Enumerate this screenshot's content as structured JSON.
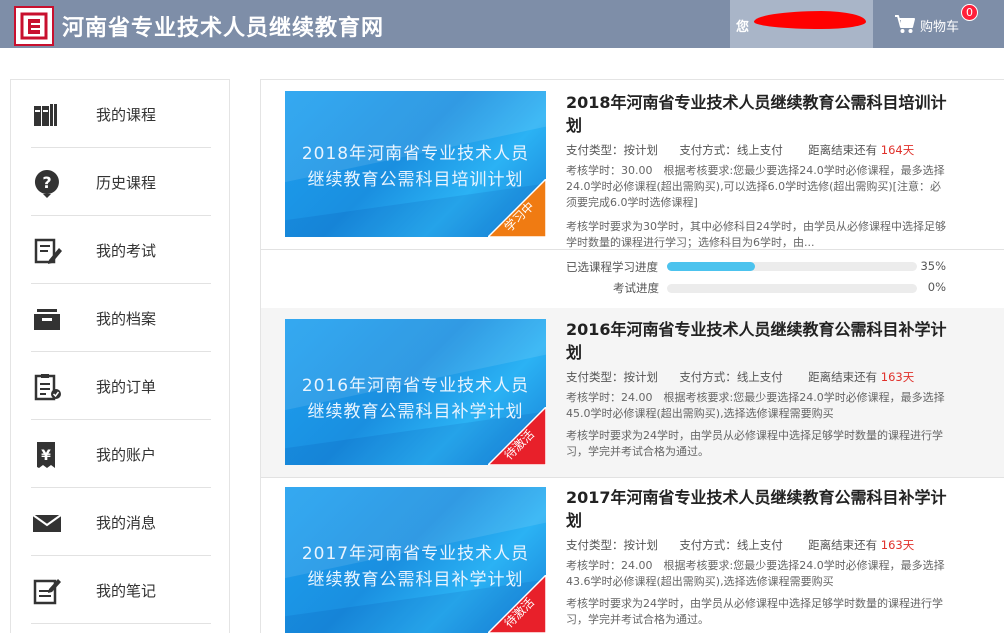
{
  "header": {
    "site_title": "河南省专业技术人员继续教育网",
    "user_greeting": "您",
    "cart_label": "购物车",
    "cart_count": "0"
  },
  "sidebar": {
    "items": [
      {
        "label": "我的课程",
        "icon": "books-icon"
      },
      {
        "label": "历史课程",
        "icon": "question-icon"
      },
      {
        "label": "我的考试",
        "icon": "exam-edit-icon"
      },
      {
        "label": "我的档案",
        "icon": "archive-box-icon"
      },
      {
        "label": "我的订单",
        "icon": "order-clipboard-icon"
      },
      {
        "label": "我的账户",
        "icon": "yen-account-icon"
      },
      {
        "label": "我的消息",
        "icon": "envelope-icon"
      },
      {
        "label": "我的笔记",
        "icon": "note-edit-icon"
      }
    ]
  },
  "courses": [
    {
      "thumb_line1": "2018年河南省专业技术人员",
      "thumb_line2": "继续教育公需科目培训计划",
      "ribbon": "学习中",
      "ribbon_color": "#f07b12",
      "title": "2018年河南省专业技术人员继续教育公需科目培训计划",
      "pay_type_label": "支付类型：",
      "pay_type": "按计划",
      "pay_method_label": "支付方式：",
      "pay_method": "线上支付",
      "remain_label": "距离结束还有",
      "remain_days": "164天",
      "assess": "考核学时：30.00　根据考核要求:您最少要选择24.0学时必修课程，最多选择24.0学时必修课程(超出需购买),可以选择6.0学时选修(超出需购买)[注意：必须要完成6.0学时选修课程]",
      "summary": "考核学时要求为30学时，其中必修科目24学时，由学员从必修课程中选择足够学时数量的课程进行学习；选修科目为6学时，由...",
      "progress_study_label": "已选课程学习进度",
      "progress_study": 0.35,
      "progress_study_text": "35%",
      "progress_exam_label": "考试进度",
      "progress_exam": 0.0,
      "progress_exam_text": "0%"
    },
    {
      "thumb_line1": "2016年河南省专业技术人员",
      "thumb_line2": "继续教育公需科目补学计划",
      "ribbon": "待激活",
      "ribbon_color": "#e8202a",
      "title": "2016年河南省专业技术人员继续教育公需科目补学计划",
      "pay_type_label": "支付类型：",
      "pay_type": "按计划",
      "pay_method_label": "支付方式：",
      "pay_method": "线上支付",
      "remain_label": "距离结束还有",
      "remain_days": "163天",
      "assess": "考核学时：24.00　根据考核要求:您最少要选择24.0学时必修课程，最多选择45.0学时必修课程(超出需购买),选择选修课程需要购买",
      "summary": "考核学时要求为24学时，由学员从必修课程中选择足够学时数量的课程进行学习，学完并考试合格为通过。"
    },
    {
      "thumb_line1": "2017年河南省专业技术人员",
      "thumb_line2": "继续教育公需科目补学计划",
      "ribbon": "待激活",
      "ribbon_color": "#e8202a",
      "title": "2017年河南省专业技术人员继续教育公需科目补学计划",
      "pay_type_label": "支付类型：",
      "pay_type": "按计划",
      "pay_method_label": "支付方式：",
      "pay_method": "线上支付",
      "remain_label": "距离结束还有",
      "remain_days": "163天",
      "assess": "考核学时：24.00　根据考核要求:您最少要选择24.0学时必修课程，最多选择43.6学时必修课程(超出需购买),选择选修课程需要购买",
      "summary": "考核学时要求为24学时，由学员从必修课程中选择足够学时数量的课程进行学习，学完并考试合格为通过。"
    }
  ]
}
